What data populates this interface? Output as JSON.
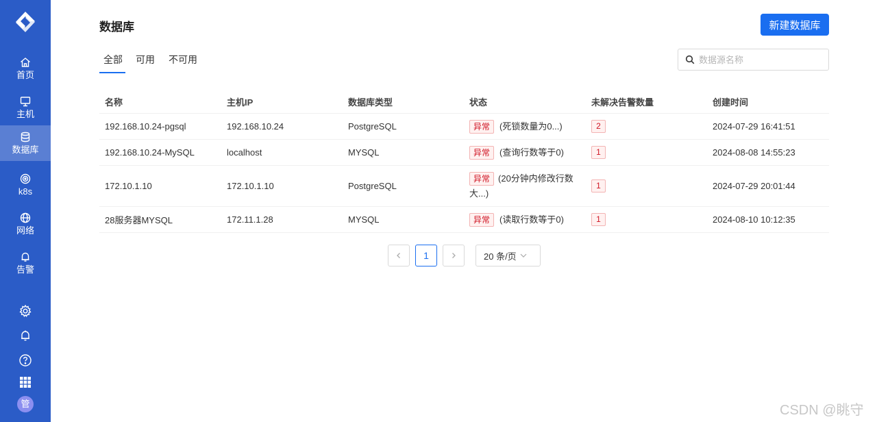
{
  "sidebar": {
    "items": [
      {
        "label": "首页",
        "icon": "home-icon"
      },
      {
        "label": "主机",
        "icon": "monitor-icon"
      },
      {
        "label": "数据库",
        "icon": "database-icon"
      },
      {
        "label": "k8s",
        "icon": "k8s-icon"
      },
      {
        "label": "网络",
        "icon": "globe-icon"
      },
      {
        "label": "告警",
        "icon": "bell-icon"
      }
    ],
    "bottom_icons": [
      "gear-icon",
      "bell-icon",
      "help-icon",
      "apps-grid-icon"
    ],
    "avatar_text": "管"
  },
  "header": {
    "title": "数据库",
    "new_button_label": "新建数据库"
  },
  "tabs": [
    {
      "label": "全部",
      "active": true
    },
    {
      "label": "可用",
      "active": false
    },
    {
      "label": "不可用",
      "active": false
    }
  ],
  "search": {
    "placeholder": "数据源名称",
    "value": ""
  },
  "table": {
    "columns": [
      "名称",
      "主机IP",
      "数据库类型",
      "状态",
      "未解决告警数量",
      "创建时间"
    ],
    "rows": [
      {
        "name": "192.168.10.24-pgsql",
        "ip": "192.168.10.24",
        "type": "PostgreSQL",
        "status_tag": "异常",
        "status_text": "(死锁数量为0...)",
        "alerts": "2",
        "created": "2024-07-29 16:41:51"
      },
      {
        "name": "192.168.10.24-MySQL",
        "ip": "localhost",
        "type": "MYSQL",
        "status_tag": "异常",
        "status_text": "(查询行数等于0)",
        "alerts": "1",
        "created": "2024-08-08 14:55:23"
      },
      {
        "name": "172.10.1.10",
        "ip": "172.10.1.10",
        "type": "PostgreSQL",
        "status_tag": "异常",
        "status_text": "(20分钟内修改行数大...)",
        "alerts": "1",
        "created": "2024-07-29 20:01:44"
      },
      {
        "name": "28服务器MYSQL",
        "ip": "172.11.1.28",
        "type": "MYSQL",
        "status_tag": "异常",
        "status_text": "(读取行数等于0)",
        "alerts": "1",
        "created": "2024-08-10 10:12:35"
      }
    ]
  },
  "pagination": {
    "current_page": "1",
    "page_size_label": "20 条/页"
  },
  "watermark": "CSDN @眺守",
  "colors": {
    "sidebar": "#2b5cc7",
    "sidebar_active": "#5a7fd3",
    "primary": "#1a6ef0",
    "danger": "#cf1322"
  }
}
